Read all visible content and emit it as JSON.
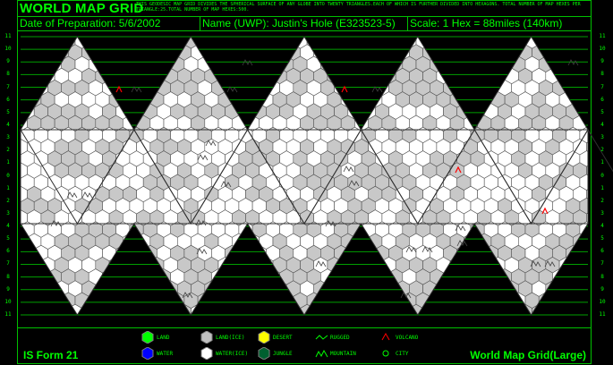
{
  "header": {
    "title": "WORLD MAP GRID",
    "description": "THIS GEODESIC MAP GRID DIVIDES THE SPHERICAL SURFACE OF ANY GLOBE INTO TWENTY TRIANGLES.EACH OF WHICH IS FURTHER DIVIDED INTO HEXAGONS. TOTAL NUMBER OF MAP HEXES PER TRIANGLE:25.TOTAL NUMBER OF MAP HEXES:500.",
    "date": "Date of Preparation: 5/6/2002",
    "name": "Name (UWP): Justin's Hole  (E323523-5)",
    "scale": "Scale: 1 Hex = 88miles (140km)"
  },
  "row_labels": [
    "11",
    "10",
    "9",
    "8",
    "7",
    "6",
    "5",
    "4",
    "3",
    "2",
    "1",
    "0",
    "1",
    "2",
    "3",
    "4",
    "5",
    "6",
    "7",
    "8",
    "9",
    "10",
    "11"
  ],
  "legend": {
    "items": [
      {
        "label": "LAND",
        "color": "#00ff00",
        "kind": "hex"
      },
      {
        "label": "WATER",
        "color": "#0000ff",
        "kind": "hex"
      },
      {
        "label": "LAND(ICE)",
        "color": "#c0c0c0",
        "kind": "hex"
      },
      {
        "label": "WATER(ICE)",
        "color": "#ffffff",
        "kind": "hex"
      },
      {
        "label": "DESERT",
        "color": "#ffff00",
        "kind": "hex"
      },
      {
        "label": "JUNGLE",
        "color": "#006030",
        "kind": "hex"
      },
      {
        "label": "RUGGED",
        "color": "#00ff00",
        "kind": "rugged-icon"
      },
      {
        "label": "MOUNTAIN",
        "color": "#00ff00",
        "kind": "mountain-icon"
      },
      {
        "label": "VOLCANO",
        "color": "#ff0000",
        "kind": "volcano-icon"
      },
      {
        "label": "CITY",
        "color": "#00ff00",
        "kind": "city-icon"
      }
    ]
  },
  "footer": {
    "form": "IS Form 21",
    "grid_name": "World Map Grid(Large)"
  },
  "colors": {
    "accent": "#00ff00",
    "land_ice": "#c8c8c8",
    "water_ice": "#ffffff",
    "volcano": "#ff0000"
  }
}
